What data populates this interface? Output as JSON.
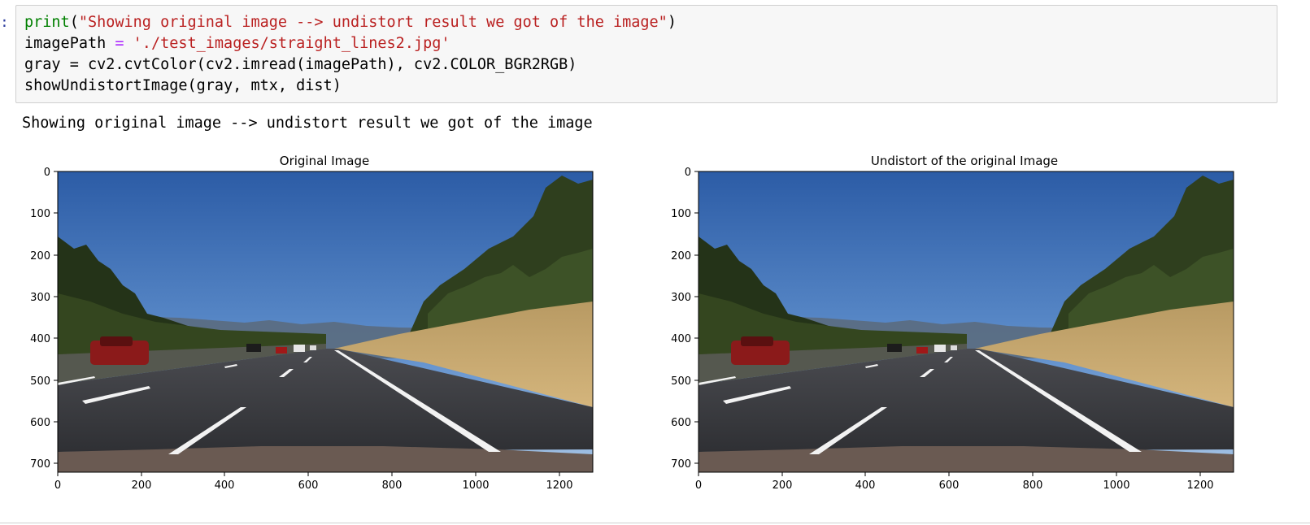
{
  "prompt_marker": ":",
  "code_cell": {
    "line1": {
      "func": "print",
      "open": "(",
      "string": "\"Showing original image --> undistort result we got of the image\"",
      "close": ")"
    },
    "line2": {
      "var": "imagePath",
      "eq": " = ",
      "string": "'./test_images/straight_lines2.jpg'"
    },
    "line3": "gray = cv2.cvtColor(cv2.imread(imagePath), cv2.COLOR_BGR2RGB)",
    "line4": "showUndistortImage(gray, mtx, dist)"
  },
  "output_text": "Showing original image --> undistort result we got of the image",
  "plots": [
    {
      "title": "Original Image",
      "x_ticks": [
        "0",
        "200",
        "400",
        "600",
        "800",
        "1000",
        "1200"
      ],
      "y_ticks": [
        "0",
        "100",
        "200",
        "300",
        "400",
        "500",
        "600",
        "700"
      ]
    },
    {
      "title": "Undistort of the original Image",
      "x_ticks": [
        "0",
        "200",
        "400",
        "600",
        "800",
        "1000",
        "1200"
      ],
      "y_ticks": [
        "0",
        "100",
        "200",
        "300",
        "400",
        "500",
        "600",
        "700"
      ]
    }
  ],
  "colors": {
    "sky_top": "#2f5fa8",
    "sky_bottom": "#9fbfe0",
    "road": "#3a3b3f",
    "grass": "#c9a76b",
    "trees": "#2c3b1c",
    "lane": "#f2f2f2",
    "car": "#8b1a1a"
  }
}
